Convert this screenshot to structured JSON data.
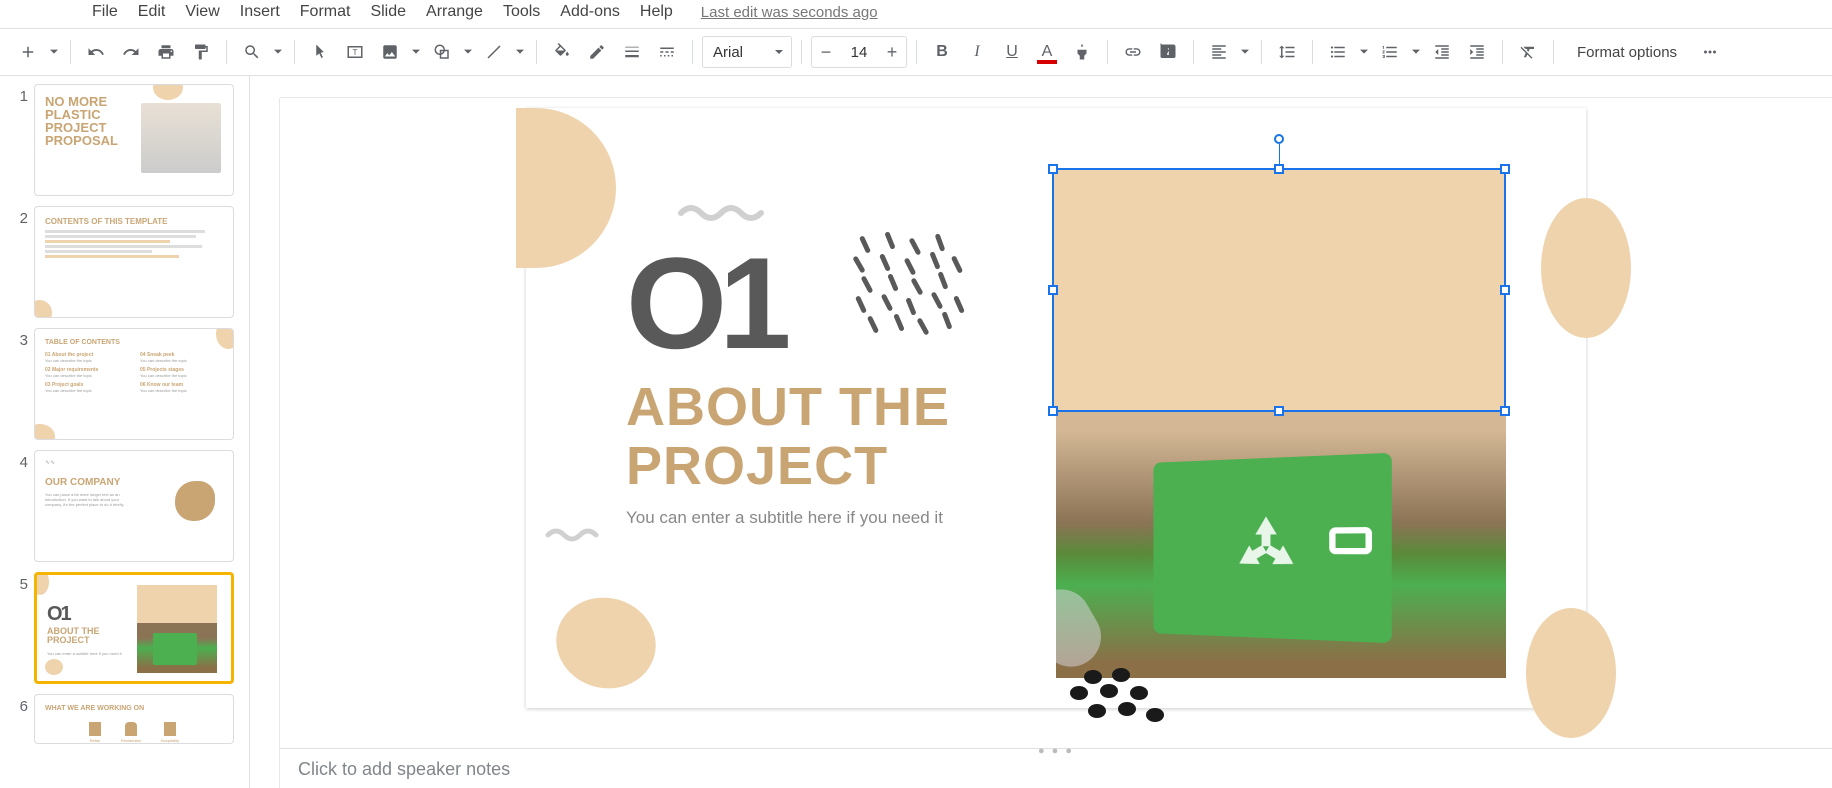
{
  "menu": {
    "items": [
      "File",
      "Edit",
      "View",
      "Insert",
      "Format",
      "Slide",
      "Arrange",
      "Tools",
      "Add-ons",
      "Help"
    ],
    "last_edit": "Last edit was seconds ago"
  },
  "toolbar": {
    "font_family": "Arial",
    "font_size": "14",
    "format_options": "Format options"
  },
  "slides": {
    "count": 6,
    "selected": 5,
    "thumbs": [
      {
        "n": 1,
        "title": "NO MORE PLASTIC PROJECT PROPOSAL"
      },
      {
        "n": 2,
        "title": "CONTENTS OF THIS TEMPLATE"
      },
      {
        "n": 3,
        "title": "TABLE OF CONTENTS",
        "items": [
          "01 About the project",
          "02 Major requirements",
          "03 Project goals",
          "04 Sneak peek",
          "05 Projects stages",
          "06 Know our team"
        ]
      },
      {
        "n": 4,
        "title": "OUR COMPANY"
      },
      {
        "n": 5,
        "title": "01 ABOUT THE PROJECT"
      },
      {
        "n": 6,
        "title": "WHAT WE ARE WORKING ON"
      }
    ]
  },
  "current_slide": {
    "number": "O1",
    "title_line1": "About the",
    "title_line2": "Project",
    "subtitle": "You can enter a subtitle here if you need it"
  },
  "notes": {
    "placeholder": "Click to add speaker notes"
  }
}
